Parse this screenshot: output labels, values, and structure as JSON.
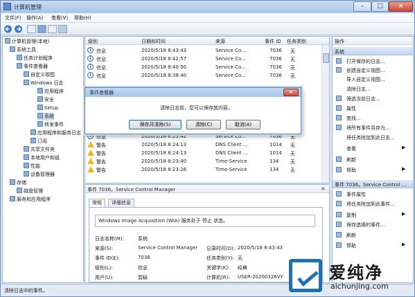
{
  "window": {
    "title": "计算机管理",
    "btn_min": "–",
    "btn_max": "□",
    "btn_close": "×"
  },
  "menus": [
    "文件(F)",
    "操作(A)",
    "查看(V)",
    "帮助(H)"
  ],
  "tree": [
    "计算机管理(本地)",
    "系统工具",
    "任务计划程序",
    "事件查看器",
    "自定义视图",
    "Windows 日志",
    "应用程序",
    "安全",
    "Setup",
    "系统",
    "转发事件",
    "应用程序和服务日志",
    "订阅",
    "共享文件夹",
    "本地用户和组",
    "性能",
    "设备管理器",
    "存储",
    "磁盘管理",
    "服务和应用程序"
  ],
  "list": {
    "headers": [
      "级别",
      "日期和时间",
      "来源",
      "事件 ID",
      "任务类别"
    ],
    "rows": [
      {
        "level": "信息",
        "icon": "info",
        "date": "2020/5/18 8:43:43",
        "source": "Service Co...",
        "id": "7036",
        "cat": "无"
      },
      {
        "level": "信息",
        "icon": "info",
        "date": "2020/5/18 8:42:57",
        "source": "Service Co...",
        "id": "7036",
        "cat": "无"
      },
      {
        "level": "信息",
        "icon": "info",
        "date": "2020/5/18 8:40:50",
        "source": "Service Co...",
        "id": "7036",
        "cat": "无"
      },
      {
        "level": "信息",
        "icon": "info",
        "date": "2020/5/18 8:38:40",
        "source": "Service Co...",
        "id": "7036",
        "cat": "无"
      },
      {
        "level": "信息",
        "icon": "info",
        "date": "2020/5/18 8:25:42",
        "source": "Service Co...",
        "id": "7036",
        "cat": "无"
      },
      {
        "level": "警告",
        "icon": "warn",
        "date": "2020/5/18 8:24:13",
        "source": "DNS Client ...",
        "id": "1014",
        "cat": "无"
      },
      {
        "level": "警告",
        "icon": "warn",
        "date": "2020/5/18 8:24:13",
        "source": "DNS Client ...",
        "id": "1014",
        "cat": "无"
      },
      {
        "level": "警告",
        "icon": "warn",
        "date": "2020/5/18 8:23:40",
        "source": "Time-Service",
        "id": "134",
        "cat": "无"
      },
      {
        "level": "警告",
        "icon": "warn",
        "date": "2020/5/18 8:23:26",
        "source": "Time-Service",
        "id": "134",
        "cat": "无"
      }
    ]
  },
  "detail": {
    "title": "事件 7036，Service Control Manager",
    "close": "×",
    "tabs": [
      "常规",
      "详细信息"
    ],
    "message": "Windows Image Acquisition (WIA) 服务处于 停止 状态。",
    "fields": {
      "log_label": "日志名称(M):",
      "log_value": "系统",
      "source_label": "来源(S):",
      "source_value": "Service Control Manager",
      "logged_label": "记录时间(D):",
      "logged_value": "2020/5/18 8:43:43",
      "id_label": "事件 ID(E):",
      "id_value": "7036",
      "task_label": "任务类别(Y):",
      "task_value": "无",
      "level_label": "级别(L):",
      "level_value": "信息",
      "keywords_label": "关键字(K):",
      "keywords_value": "经典",
      "user_label": "用户(U):",
      "user_value": "暂缺",
      "computer_label": "计算机(R):",
      "computer_value": "USER-20200326VY"
    }
  },
  "actions": {
    "header": "操作",
    "section1": "系统",
    "items1": [
      "打开保存的日志...",
      "创建自定义视图...",
      "导入自定义视图...",
      "清除日志...",
      "筛选当前日志...",
      "属性",
      "查找...",
      "将所有事件另存为...",
      "将任务附加到此日志...",
      "查看",
      "刷新",
      "帮助"
    ],
    "section2": "事件 7036，Service Control ...",
    "items2": [
      "事件属性",
      "将任务附加到此事件...",
      "复制",
      "保存选择的事件...",
      "刷新",
      "帮助"
    ]
  },
  "status": "清除日志中的事件。",
  "dialog": {
    "title": "事件查看器",
    "close": "×",
    "message": "清除日志前，您可以保存其内容。",
    "btn_save": "保存并清除(S)",
    "btn_clear": "清除(C)",
    "btn_cancel": "取消(A)"
  },
  "watermark": {
    "name": "爱纯净",
    "url": "aichunjing.com"
  }
}
